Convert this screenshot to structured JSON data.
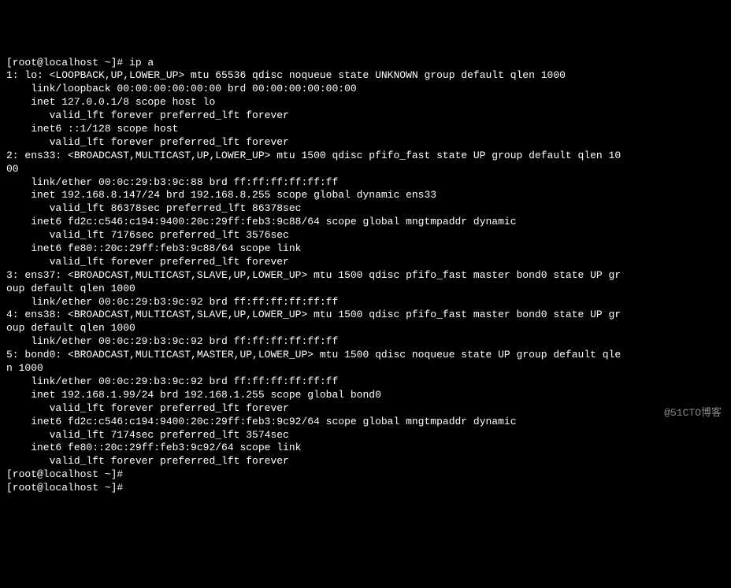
{
  "prompt1": "[root@localhost ~]# ip a",
  "lines": [
    "1: lo: <LOOPBACK,UP,LOWER_UP> mtu 65536 qdisc noqueue state UNKNOWN group default qlen 1000",
    "    link/loopback 00:00:00:00:00:00 brd 00:00:00:00:00:00",
    "    inet 127.0.0.1/8 scope host lo",
    "       valid_lft forever preferred_lft forever",
    "    inet6 ::1/128 scope host",
    "       valid_lft forever preferred_lft forever",
    "2: ens33: <BROADCAST,MULTICAST,UP,LOWER_UP> mtu 1500 qdisc pfifo_fast state UP group default qlen 10",
    "00",
    "    link/ether 00:0c:29:b3:9c:88 brd ff:ff:ff:ff:ff:ff",
    "    inet 192.168.8.147/24 brd 192.168.8.255 scope global dynamic ens33",
    "       valid_lft 86378sec preferred_lft 86378sec",
    "    inet6 fd2c:c546:c194:9400:20c:29ff:feb3:9c88/64 scope global mngtmpaddr dynamic",
    "       valid_lft 7176sec preferred_lft 3576sec",
    "    inet6 fe80::20c:29ff:feb3:9c88/64 scope link",
    "       valid_lft forever preferred_lft forever",
    "3: ens37: <BROADCAST,MULTICAST,SLAVE,UP,LOWER_UP> mtu 1500 qdisc pfifo_fast master bond0 state UP gr",
    "oup default qlen 1000",
    "    link/ether 00:0c:29:b3:9c:92 brd ff:ff:ff:ff:ff:ff",
    "4: ens38: <BROADCAST,MULTICAST,SLAVE,UP,LOWER_UP> mtu 1500 qdisc pfifo_fast master bond0 state UP gr",
    "oup default qlen 1000",
    "    link/ether 00:0c:29:b3:9c:92 brd ff:ff:ff:ff:ff:ff",
    "5: bond0: <BROADCAST,MULTICAST,MASTER,UP,LOWER_UP> mtu 1500 qdisc noqueue state UP group default qle",
    "n 1000",
    "    link/ether 00:0c:29:b3:9c:92 brd ff:ff:ff:ff:ff:ff",
    "    inet 192.168.1.99/24 brd 192.168.1.255 scope global bond0",
    "       valid_lft forever preferred_lft forever",
    "    inet6 fd2c:c546:c194:9400:20c:29ff:feb3:9c92/64 scope global mngtmpaddr dynamic",
    "       valid_lft 7174sec preferred_lft 3574sec",
    "    inet6 fe80::20c:29ff:feb3:9c92/64 scope link",
    "       valid_lft forever preferred_lft forever"
  ],
  "prompt2": "[root@localhost ~]#",
  "prompt3": "[root@localhost ~]#",
  "watermark": "@51CTO博客"
}
